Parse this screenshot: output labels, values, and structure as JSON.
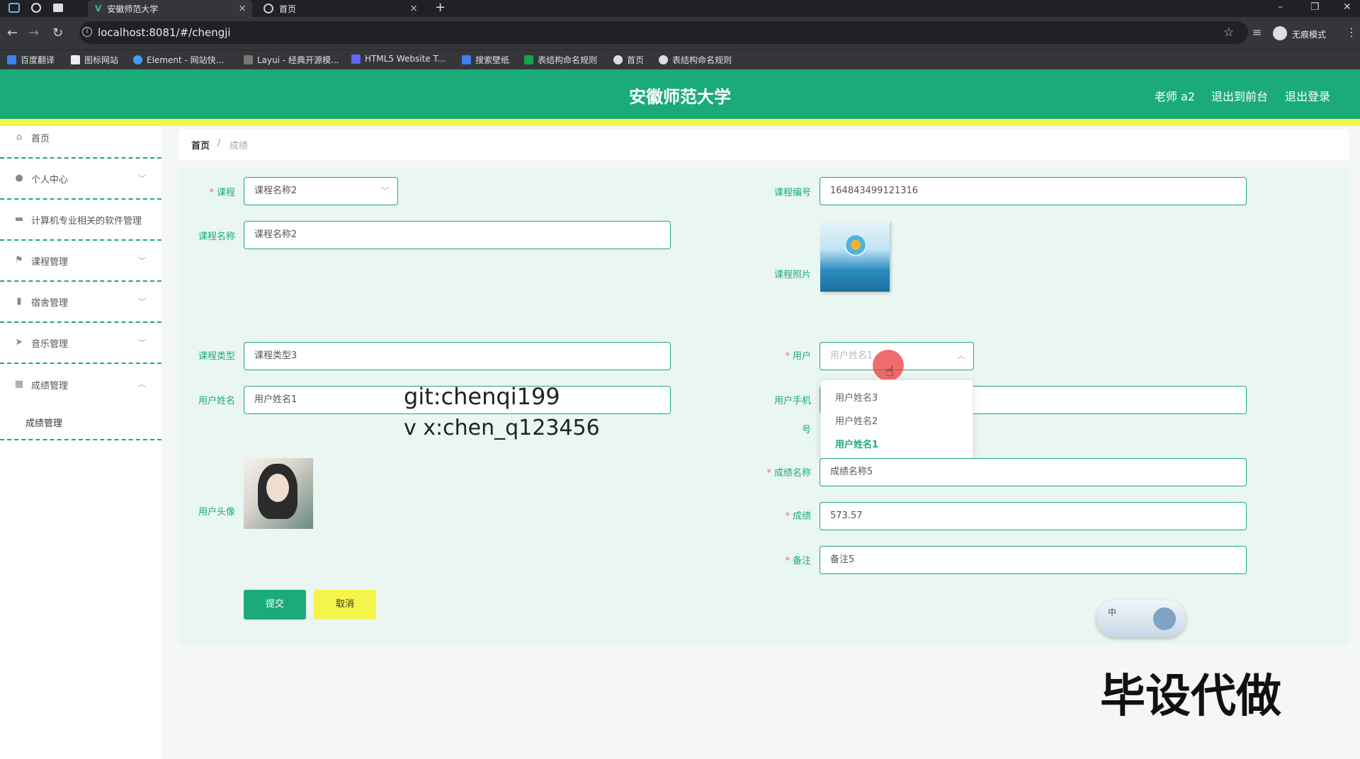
{
  "browser": {
    "tabs": [
      {
        "title": "安徽师范大学",
        "active": true
      },
      {
        "title": "首页",
        "active": false
      }
    ],
    "url": "localhost:8081/#/chengji",
    "profile_label": "无痕模式",
    "bookmarks": [
      "百度翻译",
      "图标网站",
      "Element - 网站快...",
      "Layui - 经典开源模...",
      "HTML5 Website T...",
      "搜索壁纸",
      "表结构命名规则",
      "首页",
      "表结构命名规则"
    ]
  },
  "header": {
    "title": "安徽师范大学",
    "user": "老师 a2",
    "to_front": "退出到前台",
    "logout": "退出登录"
  },
  "sidebar": {
    "items": [
      {
        "label": "首页",
        "icon": "home-icon"
      },
      {
        "label": "个人中心",
        "icon": "user-icon"
      },
      {
        "label": "计算机专业相关的软件管理",
        "icon": "briefcase-icon"
      },
      {
        "label": "课程管理",
        "icon": "flag-icon"
      },
      {
        "label": "宿舍管理",
        "icon": "bar-chart-icon"
      },
      {
        "label": "音乐管理",
        "icon": "send-icon"
      },
      {
        "label": "成绩管理",
        "icon": "grid-icon"
      }
    ],
    "sub_item": "成绩管理"
  },
  "breadcrumb": {
    "home": "首页",
    "sep": "/",
    "current": "成绩"
  },
  "form": {
    "course_label": "课程",
    "course_value": "课程名称2",
    "course_no_label": "课程编号",
    "course_no_value": "164843499121316",
    "course_name_label": "课程名称",
    "course_name_value": "课程名称2",
    "course_photo_label": "课程照片",
    "course_type_label": "课程类型",
    "course_type_value": "课程类型3",
    "user_label": "用户",
    "user_placeholder": "用户姓名1",
    "user_name_label": "用户姓名",
    "user_name_value": "用户姓名1",
    "user_phone_label_a": "用户手机",
    "user_phone_label_b": "号",
    "avatar_label": "用户头像",
    "grade_name_label": "成绩名称",
    "grade_name_value": "成绩名称5",
    "grade_label": "成绩",
    "grade_value": "573.57",
    "note_label": "备注",
    "note_value": "备注5",
    "submit": "提交",
    "cancel": "取消"
  },
  "dropdown": {
    "options": [
      "用户姓名3",
      "用户姓名2",
      "用户姓名1"
    ],
    "selected_index": 2
  },
  "ime": {
    "label": "中"
  },
  "watermarks": {
    "git": "git:chenqi199",
    "vx": "v x:chen_q123456",
    "ad": "毕设代做"
  },
  "colors": {
    "primary": "#1bab78",
    "accent": "#f4f44a",
    "required": "#f56c6c"
  }
}
